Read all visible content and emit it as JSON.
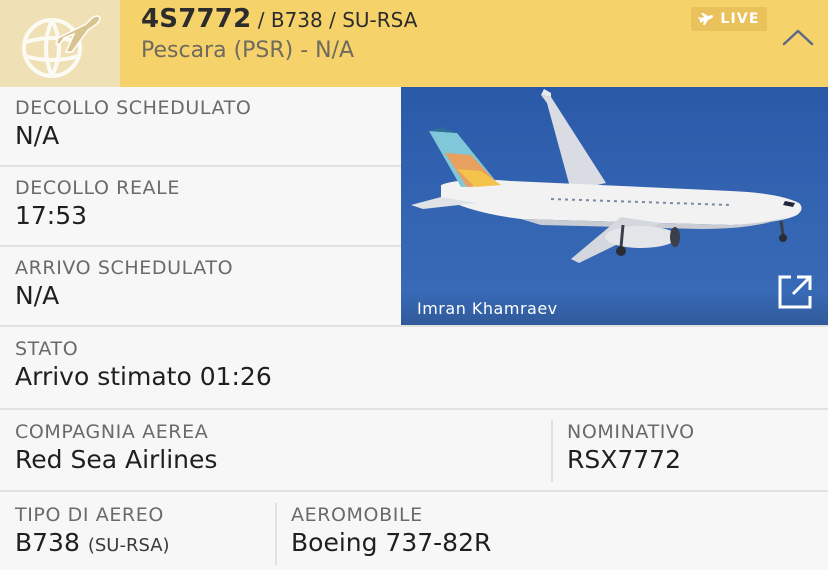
{
  "header": {
    "flight_number": "4S7772",
    "meta": " / B738 / SU-RSA",
    "route": "Pescara (PSR) - N/A",
    "live_label": "LIVE",
    "logo_icon": "globe-plane-icon",
    "live_icon": "plane-icon",
    "collapse_icon": "chevron-up-icon"
  },
  "details": {
    "scheduled_departure": {
      "label": "DECOLLO SCHEDULATO",
      "value": "N/A"
    },
    "actual_departure": {
      "label": "DECOLLO REALE",
      "value": "17:53"
    },
    "scheduled_arrival": {
      "label": "ARRIVO SCHEDULATO",
      "value": "N/A"
    },
    "status": {
      "label": "STATO",
      "value": "Arrivo stimato 01:26"
    },
    "airline": {
      "label": "COMPAGNIA AEREA",
      "value": "Red Sea Airlines"
    },
    "callsign": {
      "label": "NOMINATIVO",
      "value": "RSX7772"
    },
    "aircraft_type": {
      "label": "TIPO DI AEREO",
      "value": "B738",
      "registration": "(SU-RSA)"
    },
    "aircraft": {
      "label": "AEROMOBILE",
      "value": "Boeing 737-82R"
    }
  },
  "photo": {
    "credit": "Imran Khamraev",
    "open_icon": "external-link-icon"
  },
  "colors": {
    "header_bg": "#f6d26b",
    "logo_bg": "#f0e0b5",
    "live_badge": "#e9c25c",
    "photo_sky": "#3465b3"
  }
}
